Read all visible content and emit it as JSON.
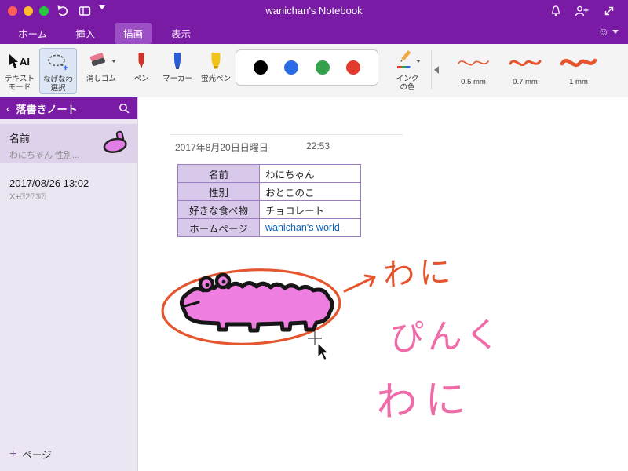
{
  "titlebar": {
    "title": "wanichan's Notebook"
  },
  "tabs": [
    {
      "label": "ホーム"
    },
    {
      "label": "挿入"
    },
    {
      "label": "描画"
    },
    {
      "label": "表示"
    }
  ],
  "ribbon": {
    "text_mode": {
      "line1": "テキスト",
      "line2": "モード",
      "icon_text": "AI"
    },
    "lasso": {
      "line1": "なげなわ",
      "line2": "選択"
    },
    "eraser_label": "消しゴム",
    "pen_label": "ペン",
    "marker_label": "マーカー",
    "highlighter_label": "蛍光ペン",
    "ink_color": {
      "line1": "インク",
      "line2": "の色"
    },
    "palette": [
      "#000000",
      "#2B6BE4",
      "#35A14C",
      "#E23B2E"
    ],
    "stroke_color": "#E5542D",
    "stroke_widths": [
      {
        "label": "0.5 mm"
      },
      {
        "label": "0.7 mm"
      },
      {
        "label": "1 mm"
      }
    ]
  },
  "sidebar": {
    "notebook_title": "落書きノート",
    "pages": [
      {
        "title": "名前",
        "subtitle": "わにちゃん 性別..."
      },
      {
        "title": "2017/08/26 13:02",
        "subtitle": "X+⍰2⍰3⍰"
      }
    ],
    "add_page_label": "ページ"
  },
  "page": {
    "date": "2017年8月20日日曜日",
    "time": "22:53",
    "table": {
      "rows": [
        {
          "h": "名前",
          "v": "わにちゃん"
        },
        {
          "h": "性別",
          "v": "おとこのこ"
        },
        {
          "h": "好きな食べ物",
          "v": "チョコレート"
        },
        {
          "h": "ホームページ",
          "v": "wanichan's world"
        }
      ]
    },
    "ink": {
      "arrow_label": "わに",
      "pink_word1": "ぴんく",
      "pink_word2": "わに",
      "red": "#E5542D",
      "pink": "#EF6BA8"
    }
  }
}
